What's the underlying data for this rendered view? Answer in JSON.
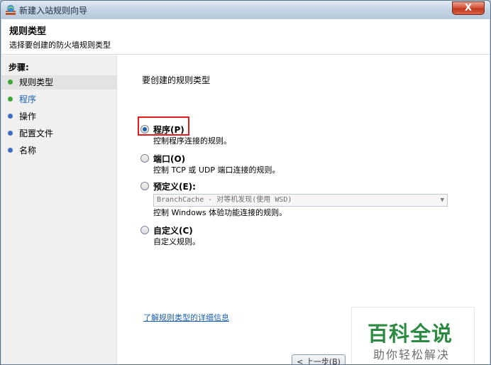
{
  "window": {
    "title": "新建入站规则向导",
    "close_glyph": "X"
  },
  "header": {
    "title": "规则类型",
    "subtitle": "选择要创建的防火墙规则类型"
  },
  "sidebar": {
    "steps_label": "步骤:",
    "items": [
      {
        "label": "规则类型",
        "dot_color": "#3aa635"
      },
      {
        "label": "程序",
        "dot_color": "#3aa635"
      },
      {
        "label": "操作",
        "dot_color": "#3f6fc2"
      },
      {
        "label": "配置文件",
        "dot_color": "#3f6fc2"
      },
      {
        "label": "名称",
        "dot_color": "#3f6fc2"
      }
    ]
  },
  "content": {
    "prompt": "要创建的规则类型",
    "options": [
      {
        "title": "程序(P)",
        "desc": "控制程序连接的规则。",
        "checked": true
      },
      {
        "title": "端口(O)",
        "desc": "控制 TCP 或 UDP 端口连接的规则。",
        "checked": false
      },
      {
        "title": "预定义(E):",
        "desc": "控制 Windows 体验功能连接的规则。",
        "checked": false
      },
      {
        "title": "自定义(C)",
        "desc": "自定义规则。",
        "checked": false
      }
    ],
    "predefined_select_value": "BranchCache - 对等机发现(使用 WSD)",
    "learn_more_link": "了解规则类型的详细信息"
  },
  "buttons": {
    "back": "< 上一步(B)",
    "next": ""
  },
  "watermark": {
    "big": "百科全说",
    "small": "助你轻松解决"
  }
}
